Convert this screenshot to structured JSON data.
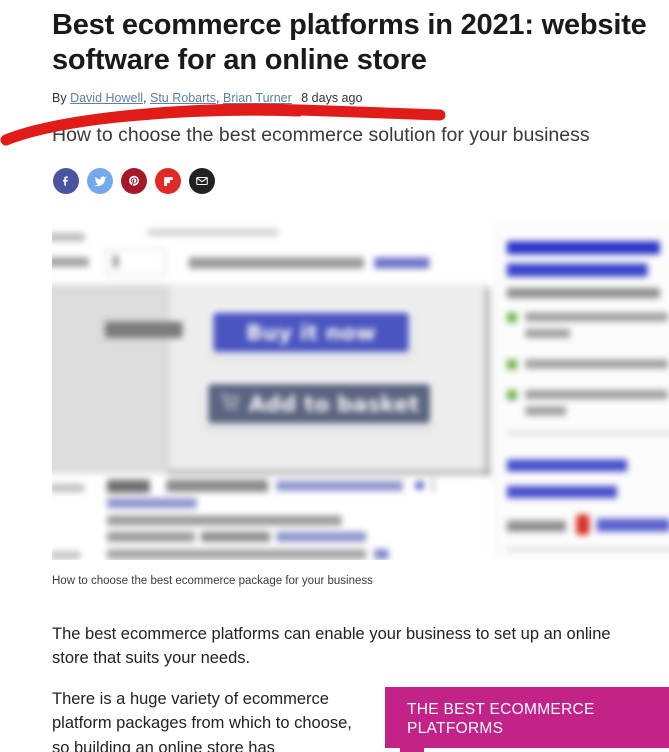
{
  "article": {
    "headline": "Best ecommerce platforms in 2021: website software for an online store",
    "byline_prefix": "By",
    "authors": [
      "David Howell",
      "Stu Robarts",
      "Brian Turner"
    ],
    "author_separator": ",",
    "timestamp": "8 days ago",
    "deck": "How to choose the best ecommerce solution for your business",
    "image_caption": "How to choose the best ecommerce package for your business",
    "paragraphs": [
      "The best ecommerce platforms can enable your business to set up an online store that suits your needs.",
      "There is a huge variety of ecommerce platform packages from which to choose, so building an online store has"
    ]
  },
  "share": {
    "items": [
      {
        "name": "facebook-share-button",
        "label": "Facebook",
        "icon": "facebook-icon",
        "color": "#4a55a2"
      },
      {
        "name": "twitter-share-button",
        "label": "Twitter",
        "icon": "twitter-icon",
        "color": "#74a9ee"
      },
      {
        "name": "pinterest-share-button",
        "label": "Pinterest",
        "icon": "pinterest-icon",
        "color": "#a61827"
      },
      {
        "name": "flipboard-share-button",
        "label": "Flipboard",
        "icon": "flipboard-icon",
        "color": "#e02a28"
      },
      {
        "name": "email-share-button",
        "label": "Email",
        "icon": "envelope-icon",
        "color": "#222222"
      }
    ]
  },
  "hero_image": {
    "alt": "Blurred ecommerce product page screenshot",
    "buy_now_label": "Buy it now",
    "add_to_basket_label": "Add to basket",
    "buy_now_color": "#4a55c0",
    "add_to_basket_color": "#5b6480"
  },
  "promo": {
    "title": "THE BEST ECOMMERCE PLATFORMS",
    "background_color": "#c32289"
  },
  "annotation": {
    "type": "red-underline-stroke",
    "color": "#e01b18"
  },
  "colors": {
    "link": "#5d7f9e",
    "text": "#222222",
    "accent_pink": "#c32289",
    "annotation_red": "#e01b18"
  }
}
